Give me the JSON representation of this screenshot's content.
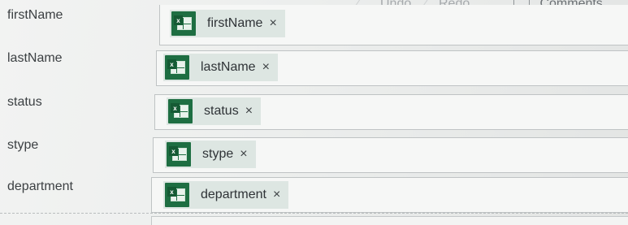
{
  "toolbar": {
    "undo_label": "Undo",
    "redo_label": "Redo",
    "comments_label": "Comments"
  },
  "fields": [
    {
      "label": "firstName",
      "token": "firstName",
      "remove": "×",
      "icon": "excel-icon"
    },
    {
      "label": "lastName",
      "token": "lastName",
      "remove": "×",
      "icon": "excel-icon"
    },
    {
      "label": "status",
      "token": "status",
      "remove": "×",
      "icon": "excel-icon"
    },
    {
      "label": "stype",
      "token": "stype",
      "remove": "×",
      "icon": "excel-icon"
    },
    {
      "label": "department",
      "token": "department",
      "remove": "×",
      "icon": "excel-icon"
    }
  ],
  "colors": {
    "excel_green": "#1e6e42",
    "chip_bg": "#dde6e2"
  }
}
